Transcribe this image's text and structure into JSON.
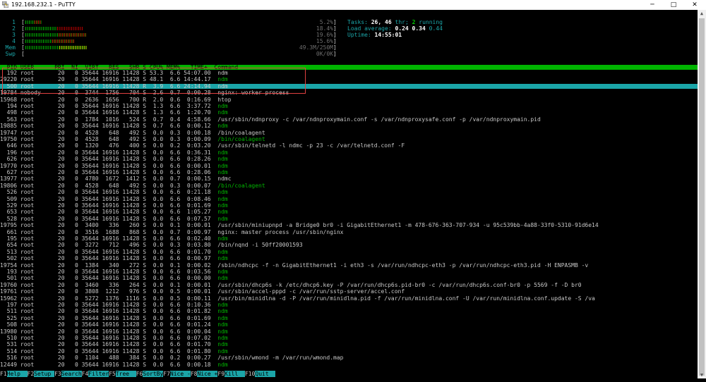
{
  "window": {
    "title": "192.168.232.1 - PuTTY",
    "buttons": {
      "minimize": "─",
      "maximize": "□",
      "close": "✕"
    }
  },
  "meters": [
    {
      "label": "1",
      "value": "5.2%",
      "fill": 0.052
    },
    {
      "label": "2",
      "value": "18.4%",
      "fill": 0.184
    },
    {
      "label": "3",
      "value": "19.6%",
      "fill": 0.196
    },
    {
      "label": "4",
      "value": "15.6%",
      "fill": 0.156
    },
    {
      "label": "Mem",
      "value": "49.3M/250M",
      "fill": 0.197
    },
    {
      "label": "Swp",
      "value": "0K/0K",
      "fill": 0
    }
  ],
  "stats": {
    "tasks_label": "Tasks:",
    "tasks": "26",
    "thr_sep": ",",
    "thr_count": "46",
    "thr_label": "thr;",
    "running": "2",
    "running_label": "running",
    "load_label": "Load average:",
    "load1": "0.24",
    "load5": "0.34",
    "load15": "0.44",
    "uptime_label": "Uptime:",
    "uptime": "14:55:01"
  },
  "header": "  PID USER      PRI  NI  VIRT   RES   SHR S CPU% MEM%   TIME+  Command",
  "processes": [
    {
      "pid": "192",
      "user": "root",
      "pri": "20",
      "ni": "0",
      "virt": "35644",
      "res": "16916",
      "shr": "11428",
      "s": "S",
      "cpu": "53.3",
      "mem": "6.6",
      "time": "54:07.00",
      "cmd": "ndm",
      "green": false
    },
    {
      "pid": "29220",
      "user": "root",
      "pri": "20",
      "ni": "0",
      "virt": "35644",
      "res": "16916",
      "shr": "11428",
      "s": "S",
      "cpu": "48.1",
      "mem": "6.6",
      "time": "14:44.17",
      "cmd": "ndm",
      "green": true
    },
    {
      "pid": "500",
      "user": "root",
      "pri": "20",
      "ni": "0",
      "virt": "35644",
      "res": "16916",
      "shr": "11428",
      "s": "R",
      "cpu": "3.9",
      "mem": "6.6",
      "time": "24:14.94",
      "cmd": "ndm",
      "green": true,
      "selected": true
    },
    {
      "pid": "19784",
      "user": "nobody",
      "pri": "20",
      "ni": "0",
      "virt": "3744",
      "res": "1756",
      "shr": "704",
      "s": "S",
      "cpu": "2.6",
      "mem": "0.7",
      "time": "0:00.28",
      "cmd": "nginx: worker process",
      "green": false
    },
    {
      "pid": "15968",
      "user": "root",
      "pri": "20",
      "ni": "0",
      "virt": "2636",
      "res": "1656",
      "shr": "700",
      "s": "R",
      "cpu": "2.0",
      "mem": "0.6",
      "time": "0:16.69",
      "cmd": "htop",
      "green": false
    },
    {
      "pid": "194",
      "user": "root",
      "pri": "20",
      "ni": "0",
      "virt": "35644",
      "res": "16916",
      "shr": "11428",
      "s": "S",
      "cpu": "1.3",
      "mem": "6.6",
      "time": "3:37.72",
      "cmd": "ndm",
      "green": true
    },
    {
      "pid": "498",
      "user": "root",
      "pri": "20",
      "ni": "0",
      "virt": "35644",
      "res": "16916",
      "shr": "11428",
      "s": "S",
      "cpu": "1.3",
      "mem": "6.6",
      "time": "1:20.70",
      "cmd": "ndm",
      "green": true
    },
    {
      "pid": "563",
      "user": "root",
      "pri": "20",
      "ni": "0",
      "virt": "1784",
      "res": "1016",
      "shr": "524",
      "s": "S",
      "cpu": "0.7",
      "mem": "0.4",
      "time": "4:58.66",
      "cmd": "/usr/sbin/ndnproxy -c /var/ndnproxymain.conf -s /var/ndnproxysafe.conf -p /var/ndnproxymain.pid",
      "green": false
    },
    {
      "pid": "19885",
      "user": "root",
      "pri": "20",
      "ni": "0",
      "virt": "35644",
      "res": "16916",
      "shr": "11428",
      "s": "S",
      "cpu": "0.7",
      "mem": "6.6",
      "time": "0:00.12",
      "cmd": "ndm",
      "green": true
    },
    {
      "pid": "19747",
      "user": "root",
      "pri": "20",
      "ni": "0",
      "virt": "4528",
      "res": "648",
      "shr": "492",
      "s": "S",
      "cpu": "0.0",
      "mem": "0.3",
      "time": "0:00.18",
      "cmd": "/bin/coalagent",
      "green": false
    },
    {
      "pid": "19750",
      "user": "root",
      "pri": "20",
      "ni": "0",
      "virt": "4528",
      "res": "648",
      "shr": "492",
      "s": "S",
      "cpu": "0.0",
      "mem": "0.3",
      "time": "0:00.09",
      "cmd": "/bin/coalagent",
      "green": true
    },
    {
      "pid": "646",
      "user": "root",
      "pri": "20",
      "ni": "0",
      "virt": "1320",
      "res": "476",
      "shr": "400",
      "s": "S",
      "cpu": "0.0",
      "mem": "0.2",
      "time": "0:03.20",
      "cmd": "/usr/sbin/telnetd -l ndmc -p 23 -c /var/telnetd.conf -F",
      "green": false
    },
    {
      "pid": "196",
      "user": "root",
      "pri": "20",
      "ni": "0",
      "virt": "35644",
      "res": "16916",
      "shr": "11428",
      "s": "S",
      "cpu": "0.0",
      "mem": "6.6",
      "time": "0:36.31",
      "cmd": "ndm",
      "green": true
    },
    {
      "pid": "626",
      "user": "root",
      "pri": "20",
      "ni": "0",
      "virt": "35644",
      "res": "16916",
      "shr": "11428",
      "s": "S",
      "cpu": "0.0",
      "mem": "6.6",
      "time": "0:28.26",
      "cmd": "ndm",
      "green": true
    },
    {
      "pid": "19770",
      "user": "root",
      "pri": "20",
      "ni": "0",
      "virt": "35644",
      "res": "16916",
      "shr": "11428",
      "s": "S",
      "cpu": "0.0",
      "mem": "6.6",
      "time": "0:00.01",
      "cmd": "ndm",
      "green": true
    },
    {
      "pid": "627",
      "user": "root",
      "pri": "20",
      "ni": "0",
      "virt": "35644",
      "res": "16916",
      "shr": "11428",
      "s": "S",
      "cpu": "0.0",
      "mem": "6.6",
      "time": "0:28.06",
      "cmd": "ndm",
      "green": true
    },
    {
      "pid": "13977",
      "user": "root",
      "pri": "20",
      "ni": "0",
      "virt": "4780",
      "res": "1672",
      "shr": "1412",
      "s": "S",
      "cpu": "0.0",
      "mem": "0.7",
      "time": "0:00.15",
      "cmd": "ndmc",
      "green": false
    },
    {
      "pid": "19806",
      "user": "root",
      "pri": "20",
      "ni": "0",
      "virt": "4528",
      "res": "648",
      "shr": "492",
      "s": "S",
      "cpu": "0.0",
      "mem": "0.3",
      "time": "0:00.07",
      "cmd": "/bin/coalagent",
      "green": true
    },
    {
      "pid": "526",
      "user": "root",
      "pri": "20",
      "ni": "0",
      "virt": "35644",
      "res": "16916",
      "shr": "11428",
      "s": "S",
      "cpu": "0.0",
      "mem": "6.6",
      "time": "0:21.18",
      "cmd": "ndm",
      "green": true
    },
    {
      "pid": "509",
      "user": "root",
      "pri": "20",
      "ni": "0",
      "virt": "35644",
      "res": "16916",
      "shr": "11428",
      "s": "S",
      "cpu": "0.0",
      "mem": "6.6",
      "time": "0:08.46",
      "cmd": "ndm",
      "green": true
    },
    {
      "pid": "529",
      "user": "root",
      "pri": "20",
      "ni": "0",
      "virt": "35644",
      "res": "16916",
      "shr": "11428",
      "s": "S",
      "cpu": "0.0",
      "mem": "6.6",
      "time": "0:01.69",
      "cmd": "ndm",
      "green": true
    },
    {
      "pid": "653",
      "user": "root",
      "pri": "20",
      "ni": "0",
      "virt": "35644",
      "res": "16916",
      "shr": "11428",
      "s": "S",
      "cpu": "0.0",
      "mem": "6.6",
      "time": "1:05.27",
      "cmd": "ndm",
      "green": true
    },
    {
      "pid": "528",
      "user": "root",
      "pri": "20",
      "ni": "0",
      "virt": "35644",
      "res": "16916",
      "shr": "11428",
      "s": "S",
      "cpu": "0.0",
      "mem": "6.6",
      "time": "0:07.57",
      "cmd": "ndm",
      "green": true
    },
    {
      "pid": "19795",
      "user": "root",
      "pri": "20",
      "ni": "0",
      "virt": "3400",
      "res": "336",
      "shr": "260",
      "s": "S",
      "cpu": "0.0",
      "mem": "0.1",
      "time": "0:00.01",
      "cmd": "/usr/sbin/miniupnpd -a Bridge0 br0 -i GigabitEthernet1 -m 478-676-363-707-934 -u 95c539bb-4a88-33f0-5310-91d6e14",
      "green": false
    },
    {
      "pid": "661",
      "user": "root",
      "pri": "20",
      "ni": "0",
      "virt": "3516",
      "res": "1688",
      "shr": "868",
      "s": "S",
      "cpu": "0.0",
      "mem": "0.7",
      "time": "0:00.97",
      "cmd": "nginx: master process /usr/sbin/nginx",
      "green": false
    },
    {
      "pid": "195",
      "user": "root",
      "pri": "20",
      "ni": "0",
      "virt": "35644",
      "res": "16916",
      "shr": "11428",
      "s": "S",
      "cpu": "0.0",
      "mem": "6.6",
      "time": "0:02.40",
      "cmd": "ndm",
      "green": true
    },
    {
      "pid": "654",
      "user": "root",
      "pri": "20",
      "ni": "0",
      "virt": "3272",
      "res": "712",
      "shr": "496",
      "s": "S",
      "cpu": "0.0",
      "mem": "0.3",
      "time": "0:03.80",
      "cmd": "/bin/nqnd -i 50ff20001593",
      "green": false
    },
    {
      "pid": "513",
      "user": "root",
      "pri": "20",
      "ni": "0",
      "virt": "35644",
      "res": "16916",
      "shr": "11428",
      "s": "S",
      "cpu": "0.0",
      "mem": "6.6",
      "time": "0:01.70",
      "cmd": "ndm",
      "green": true
    },
    {
      "pid": "502",
      "user": "root",
      "pri": "20",
      "ni": "0",
      "virt": "35644",
      "res": "16916",
      "shr": "11428",
      "s": "S",
      "cpu": "0.0",
      "mem": "6.6",
      "time": "0:00.97",
      "cmd": "ndm",
      "green": true
    },
    {
      "pid": "19754",
      "user": "root",
      "pri": "20",
      "ni": "0",
      "virt": "1384",
      "res": "340",
      "shr": "272",
      "s": "S",
      "cpu": "0.0",
      "mem": "0.1",
      "time": "0:00.02",
      "cmd": "/sbin/ndhcpc -f -n GigabitEthernet1 -i eth3 -s /var/run/ndhcpc-eth3 -p /var/run/ndhcpc-eth3.pid -H ENPASMB -v",
      "green": false
    },
    {
      "pid": "193",
      "user": "root",
      "pri": "20",
      "ni": "0",
      "virt": "35644",
      "res": "16916",
      "shr": "11428",
      "s": "S",
      "cpu": "0.0",
      "mem": "6.6",
      "time": "0:03.56",
      "cmd": "ndm",
      "green": true
    },
    {
      "pid": "501",
      "user": "root",
      "pri": "20",
      "ni": "0",
      "virt": "35644",
      "res": "16916",
      "shr": "11428",
      "s": "S",
      "cpu": "0.0",
      "mem": "6.6",
      "time": "0:00.00",
      "cmd": "ndm",
      "green": true
    },
    {
      "pid": "19760",
      "user": "root",
      "pri": "20",
      "ni": "0",
      "virt": "3460",
      "res": "336",
      "shr": "264",
      "s": "S",
      "cpu": "0.0",
      "mem": "0.1",
      "time": "0:00.01",
      "cmd": "/usr/sbin/dhcp6s -k /etc/dhcp6.key -P /var/run/dhcp6s.pid-br0 -c /var/run/dhcp6s.conf-br0 -p 5569 -f -D br0",
      "green": false
    },
    {
      "pid": "19761",
      "user": "root",
      "pri": "20",
      "ni": "0",
      "virt": "3808",
      "res": "1212",
      "shr": "976",
      "s": "S",
      "cpu": "0.0",
      "mem": "0.5",
      "time": "0:00.01",
      "cmd": "/usr/sbin/accel-pppd -c /var/run/sstp-server/accel.conf",
      "green": false
    },
    {
      "pid": "15962",
      "user": "root",
      "pri": "20",
      "ni": "0",
      "virt": "5272",
      "res": "1376",
      "shr": "1116",
      "s": "S",
      "cpu": "0.0",
      "mem": "0.5",
      "time": "0:00.11",
      "cmd": "/usr/bin/minidlna -d -P /var/run/minidlna.pid -f /var/run/minidlna.conf -U /var/run/minidlna.conf.update -S /va",
      "green": false
    },
    {
      "pid": "197",
      "user": "root",
      "pri": "20",
      "ni": "0",
      "virt": "35644",
      "res": "16916",
      "shr": "11428",
      "s": "S",
      "cpu": "0.0",
      "mem": "6.6",
      "time": "0:10.36",
      "cmd": "ndm",
      "green": true
    },
    {
      "pid": "511",
      "user": "root",
      "pri": "20",
      "ni": "0",
      "virt": "35644",
      "res": "16916",
      "shr": "11428",
      "s": "S",
      "cpu": "0.0",
      "mem": "6.6",
      "time": "0:01.82",
      "cmd": "ndm",
      "green": true
    },
    {
      "pid": "525",
      "user": "root",
      "pri": "20",
      "ni": "0",
      "virt": "35644",
      "res": "16916",
      "shr": "11428",
      "s": "S",
      "cpu": "0.0",
      "mem": "6.6",
      "time": "0:01.69",
      "cmd": "ndm",
      "green": true
    },
    {
      "pid": "508",
      "user": "root",
      "pri": "20",
      "ni": "0",
      "virt": "35644",
      "res": "16916",
      "shr": "11428",
      "s": "S",
      "cpu": "0.0",
      "mem": "6.6",
      "time": "0:01.24",
      "cmd": "ndm",
      "green": true
    },
    {
      "pid": "13980",
      "user": "root",
      "pri": "20",
      "ni": "0",
      "virt": "35644",
      "res": "16916",
      "shr": "11428",
      "s": "S",
      "cpu": "0.0",
      "mem": "6.6",
      "time": "0:00.04",
      "cmd": "ndm",
      "green": true
    },
    {
      "pid": "510",
      "user": "root",
      "pri": "20",
      "ni": "0",
      "virt": "35644",
      "res": "16916",
      "shr": "11428",
      "s": "S",
      "cpu": "0.0",
      "mem": "6.6",
      "time": "0:07.02",
      "cmd": "ndm",
      "green": true
    },
    {
      "pid": "531",
      "user": "root",
      "pri": "20",
      "ni": "0",
      "virt": "35644",
      "res": "16916",
      "shr": "11428",
      "s": "S",
      "cpu": "0.0",
      "mem": "6.6",
      "time": "0:01.70",
      "cmd": "ndm",
      "green": true
    },
    {
      "pid": "514",
      "user": "root",
      "pri": "20",
      "ni": "0",
      "virt": "35644",
      "res": "16916",
      "shr": "11428",
      "s": "S",
      "cpu": "0.0",
      "mem": "6.6",
      "time": "0:01.80",
      "cmd": "ndm",
      "green": true
    },
    {
      "pid": "516",
      "user": "root",
      "pri": "20",
      "ni": "0",
      "virt": "1104",
      "res": "488",
      "shr": "384",
      "s": "S",
      "cpu": "0.0",
      "mem": "0.2",
      "time": "0:00.27",
      "cmd": "/usr/sbin/wmond -m /var/run/wmond.map",
      "green": false
    },
    {
      "pid": "12449",
      "user": "root",
      "pri": "20",
      "ni": "0",
      "virt": "35644",
      "res": "16916",
      "shr": "11428",
      "s": "S",
      "cpu": "0.0",
      "mem": "6.6",
      "time": "0:00.18",
      "cmd": "ndm",
      "green": true
    }
  ],
  "footer": [
    {
      "key": "F1",
      "label": "Help  "
    },
    {
      "key": "F2",
      "label": "Setup "
    },
    {
      "key": "F3",
      "label": "Search"
    },
    {
      "key": "F4",
      "label": "Filter"
    },
    {
      "key": "F5",
      "label": "Tree  "
    },
    {
      "key": "F6",
      "label": "SortBy"
    },
    {
      "key": "F7",
      "label": "Nice -"
    },
    {
      "key": "F8",
      "label": "Nice +"
    },
    {
      "key": "F9",
      "label": "Kill  "
    },
    {
      "key": "F10",
      "label": "Quit  "
    }
  ],
  "colors": {
    "accent": "#1ba5a8",
    "header_bg": "#00b400",
    "green_text": "#00b400",
    "highlight_box": "#e04040"
  }
}
